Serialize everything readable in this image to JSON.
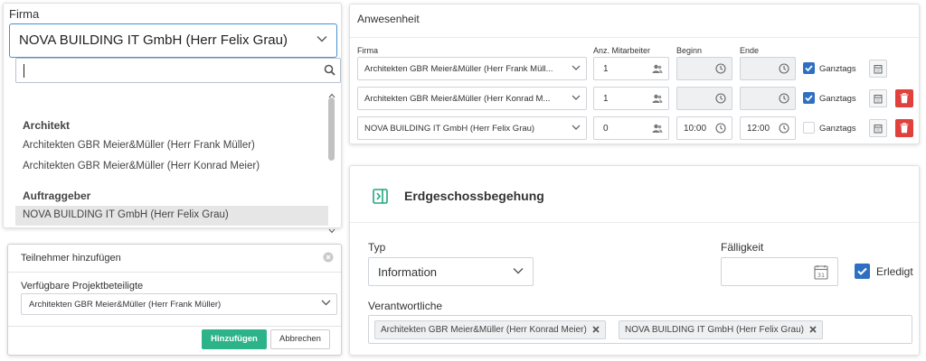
{
  "firma_dropdown": {
    "label": "Firma",
    "selected": "NOVA BUILDING IT GmbH (Herr Felix Grau)",
    "search_value": "",
    "groups": [
      {
        "name": "Architekt",
        "options": [
          "Architekten GBR Meier&Müller (Herr Frank Müller)",
          "Architekten GBR Meier&Müller (Herr Konrad Meier)"
        ]
      },
      {
        "name": "Auftraggeber",
        "options": [
          "NOVA BUILDING IT GmbH (Herr Felix Grau)"
        ]
      }
    ]
  },
  "add_participant": {
    "title": "Teilnehmer hinzufügen",
    "field_label": "Verfügbare Projektbeteiligte",
    "selected": "Architekten GBR Meier&Müller (Herr Frank Müller)",
    "add_label": "Hinzufügen",
    "cancel_label": "Abbrechen"
  },
  "attendance": {
    "title": "Anwesenheit",
    "headers": {
      "firma": "Firma",
      "count": "Anz. Mitarbeiter",
      "begin": "Beginn",
      "end": "Ende"
    },
    "checkbox_label": "Ganztags",
    "rows": [
      {
        "firma": "Architekten GBR Meier&Müller (Herr Frank Müll...",
        "count": "1",
        "begin": "",
        "end": "",
        "ganztags": true
      },
      {
        "firma": "Architekten GBR Meier&Müller (Herr Konrad M...",
        "count": "1",
        "begin": "",
        "end": "",
        "ganztags": true
      },
      {
        "firma": "NOVA BUILDING IT GmbH (Herr Felix Grau)",
        "count": "0",
        "begin": "10:00",
        "end": "12:00",
        "ganztags": false
      }
    ]
  },
  "task": {
    "title": "Erdgeschossbegehung",
    "type_label": "Typ",
    "type_value": "Information",
    "due_label": "Fälligkeit",
    "due_value": "",
    "done_label": "Erledigt",
    "done": true,
    "responsible_label": "Verantwortliche",
    "responsible": [
      "Architekten GBR Meier&Müller (Herr Konrad Meier)",
      "NOVA BUILDING IT GmbH (Herr Felix Grau)"
    ]
  },
  "colors": {
    "accent_blue": "#2f6fc2",
    "focus_blue": "#4a8fd4",
    "green": "#2db389",
    "teal_icon": "#21a77f",
    "danger": "#e0413d"
  }
}
